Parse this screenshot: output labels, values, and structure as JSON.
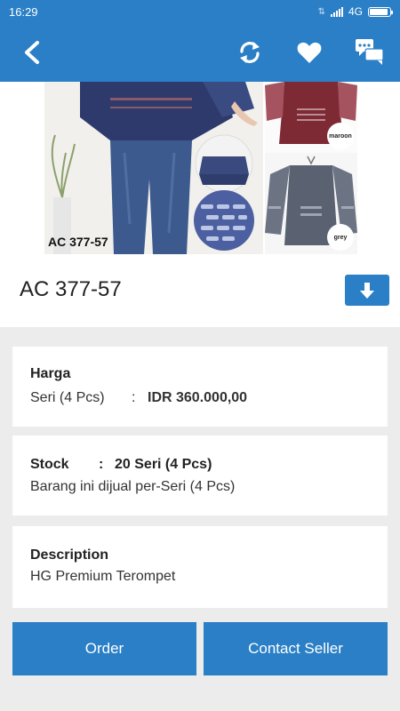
{
  "status": {
    "time": "16:29",
    "network": "4G",
    "battery_level": 0.9
  },
  "app_bar": {
    "back_icon": "back-arrow-icon",
    "refresh_icon": "refresh-icon",
    "favorite_icon": "heart-icon",
    "chat_icon": "chat-icon"
  },
  "hero": {
    "code_label": "AC 377-57",
    "swatch_1": "maroon",
    "swatch_2": "grey"
  },
  "product": {
    "title": "AC 377-57"
  },
  "price_card": {
    "label": "Harga",
    "unit": "Seri (4 Pcs)",
    "colon": ":",
    "price": "IDR 360.000,00"
  },
  "stock_card": {
    "label": "Stock",
    "colon": ":",
    "value": "20 Seri (4 Pcs)",
    "note": "Barang ini dijual per-Seri (4 Pcs)"
  },
  "description_card": {
    "label": "Description",
    "text": "HG Premium Terompet"
  },
  "actions": {
    "order": "Order",
    "contact": "Contact Seller"
  },
  "colors": {
    "primary": "#2a7fc6",
    "price": "#e3171a",
    "background": "#ececec"
  }
}
